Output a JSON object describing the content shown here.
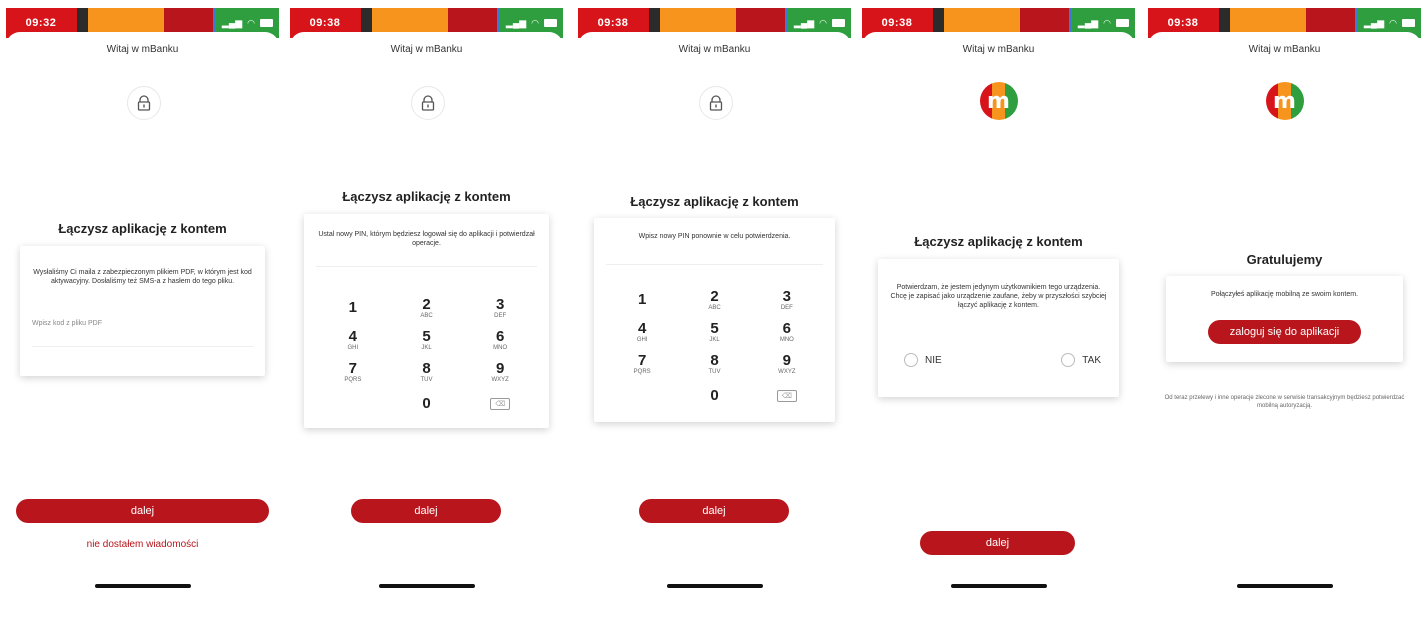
{
  "colors": {
    "red": "#d8141b",
    "dark": "#2b2b2b",
    "orange": "#f7941d",
    "crimson": "#b8161c",
    "blue": "#3a7bd5",
    "green": "#2e9e3e",
    "button": "#b8161c"
  },
  "app_title": "Witaj w mBanku",
  "screens": [
    {
      "time": "09:32",
      "heading": "Łączysz aplikację z kontem",
      "card_text": "Wysłaliśmy Ci maila z zabezpieczonym plikiem PDF, w którym jest kod aktywacyjny. Dosłaliśmy też SMS-a z hasłem do tego pliku.",
      "field_label": "Wpisz kod z pliku PDF",
      "primary_button": "dalej",
      "secondary_link": "nie dostałem wiadomości",
      "icon": "lock-icon"
    },
    {
      "time": "09:38",
      "heading": "Łączysz aplikację z kontem",
      "card_text": "Ustal nowy PIN, którym będziesz logował się do aplikacji i potwierdzał operacje.",
      "primary_button": "dalej",
      "icon": "lock-icon"
    },
    {
      "time": "09:38",
      "heading": "Łączysz aplikację z kontem",
      "card_text": "Wpisz nowy PIN ponownie w celu potwierdzenia.",
      "primary_button": "dalej",
      "icon": "lock-icon"
    },
    {
      "time": "09:38",
      "heading": "Łączysz aplikację z kontem",
      "card_text": "Potwierdzam, że jestem jedynym użytkownikiem tego urządzenia. Chcę je zapisać jako urządzenie zaufane, żeby w przyszłości szybciej łączyć aplikację z kontem.",
      "option_no": "NIE",
      "option_yes": "TAK",
      "primary_button": "dalej",
      "icon": "mbank-logo"
    },
    {
      "time": "09:38",
      "heading": "Gratulujemy",
      "card_text": "Połączyłeś aplikację mobilną ze swoim kontem.",
      "primary_button": "zaloguj się do aplikacji",
      "footnote": "Od teraz przelewy i inne operacje zlecone w serwisie transakcyjnym będziesz potwierdzać mobilną autoryzacją.",
      "icon": "mbank-logo"
    }
  ],
  "keypad": [
    {
      "digit": "1",
      "letters": ""
    },
    {
      "digit": "2",
      "letters": "ABC"
    },
    {
      "digit": "3",
      "letters": "DEF"
    },
    {
      "digit": "4",
      "letters": "GHI"
    },
    {
      "digit": "5",
      "letters": "JKL"
    },
    {
      "digit": "6",
      "letters": "MNO"
    },
    {
      "digit": "7",
      "letters": "PQRS"
    },
    {
      "digit": "8",
      "letters": "TUV"
    },
    {
      "digit": "9",
      "letters": "WXYZ"
    },
    {
      "digit": "",
      "letters": ""
    },
    {
      "digit": "0",
      "letters": ""
    },
    {
      "digit": "⌫",
      "letters": ""
    }
  ]
}
